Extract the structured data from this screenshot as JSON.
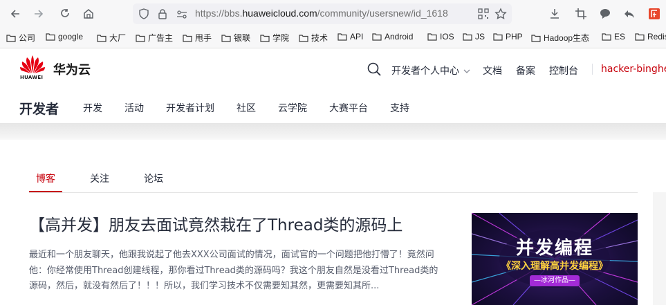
{
  "browser": {
    "url_prefix": "https://bbs.",
    "url_domain": "huaweicloud.com",
    "url_path": "/community/usersnew/id_1618",
    "bookmarks": [
      "公司",
      "google",
      "大厂",
      "广告主",
      "甩手",
      "银联",
      "学院",
      "技术",
      "API",
      "Android",
      "IOS",
      "JS",
      "PHP",
      "Hadoop生态",
      "ES",
      "Redis"
    ]
  },
  "header": {
    "logo_text": "华为云",
    "logo_sub": "HUAWEI",
    "dev_center": "开发者个人中心",
    "docs": "文档",
    "record": "备案",
    "console": "控制台",
    "username": "hacker-binghe"
  },
  "subnav": {
    "brand": "开发者",
    "items": [
      "开发",
      "活动",
      "开发者计划",
      "社区",
      "云学院",
      "大赛平台",
      "支持"
    ]
  },
  "tabs": [
    "博客",
    "关注",
    "论坛"
  ],
  "post": {
    "title": "【高并发】朋友去面试竟然栽在了Thread类的源码上",
    "summary": "最近和一个朋友聊天，他跟我说起了他去XXX公司面试的情况，面试官的一个问题把他打懵了！竟然问他：你经常使用Thread创建线程，那你看过Thread类的源码吗？我这个朋友自然是没看过Thread类的源码，然后，就没有然后了！！！所以，我们学习技术不仅需要知其然，更需要知其所..."
  },
  "cover": {
    "title": "并发编程",
    "subtitle": "《深入理解高并发编程》",
    "author": "—冰河作品—"
  },
  "colors": {
    "accent": "#c7000b",
    "text": "#252b3a"
  }
}
